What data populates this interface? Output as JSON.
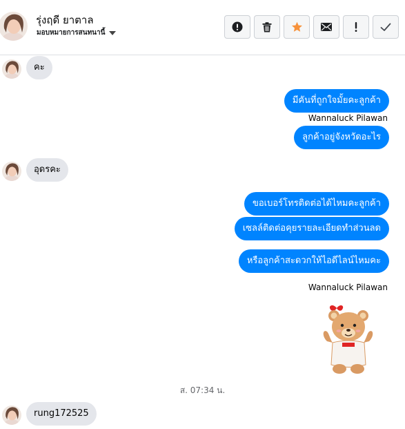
{
  "header": {
    "contact_name": "รุ่งฤดี ยาตาล",
    "assign_label": "มอบหมายการสนทนานี้",
    "actions": [
      {
        "name": "report-button",
        "icon": "alert-circle-icon"
      },
      {
        "name": "delete-button",
        "icon": "trash-icon"
      },
      {
        "name": "star-button",
        "icon": "star-icon",
        "color": "#f7923b"
      },
      {
        "name": "mark-unread-button",
        "icon": "envelope-icon"
      },
      {
        "name": "important-button",
        "icon": "exclamation-icon"
      },
      {
        "name": "done-button",
        "icon": "checkmark-icon"
      }
    ]
  },
  "messages": {
    "m1": "คะ",
    "m2": "มีคันที่ถูกใจมั้ยคะลูกค้า",
    "sender1": "Wannaluck Pilawan",
    "m3": "ลูกค้าอยู่จังหวัดอะไร",
    "m4": "อุดรคะ",
    "m5": "ขอเบอร์โทรติดต่อได้ไหมคะลูกค้า",
    "m6": "เซลล์ติดต่อคุยรายละเอียดทำส่วนลด",
    "m7": "หรือลูกค้าสะดวกให้ไอดีไลน์ไหมคะ",
    "sender2": "Wannaluck Pilawan",
    "sticker": "teddy-bear-sticker",
    "timestamp": "ส. 07:34 น.",
    "m8": "rung172525"
  },
  "colors": {
    "outgoing_bubble": "#0084ff",
    "incoming_bubble": "#e4e6eb",
    "star": "#f7923b"
  }
}
